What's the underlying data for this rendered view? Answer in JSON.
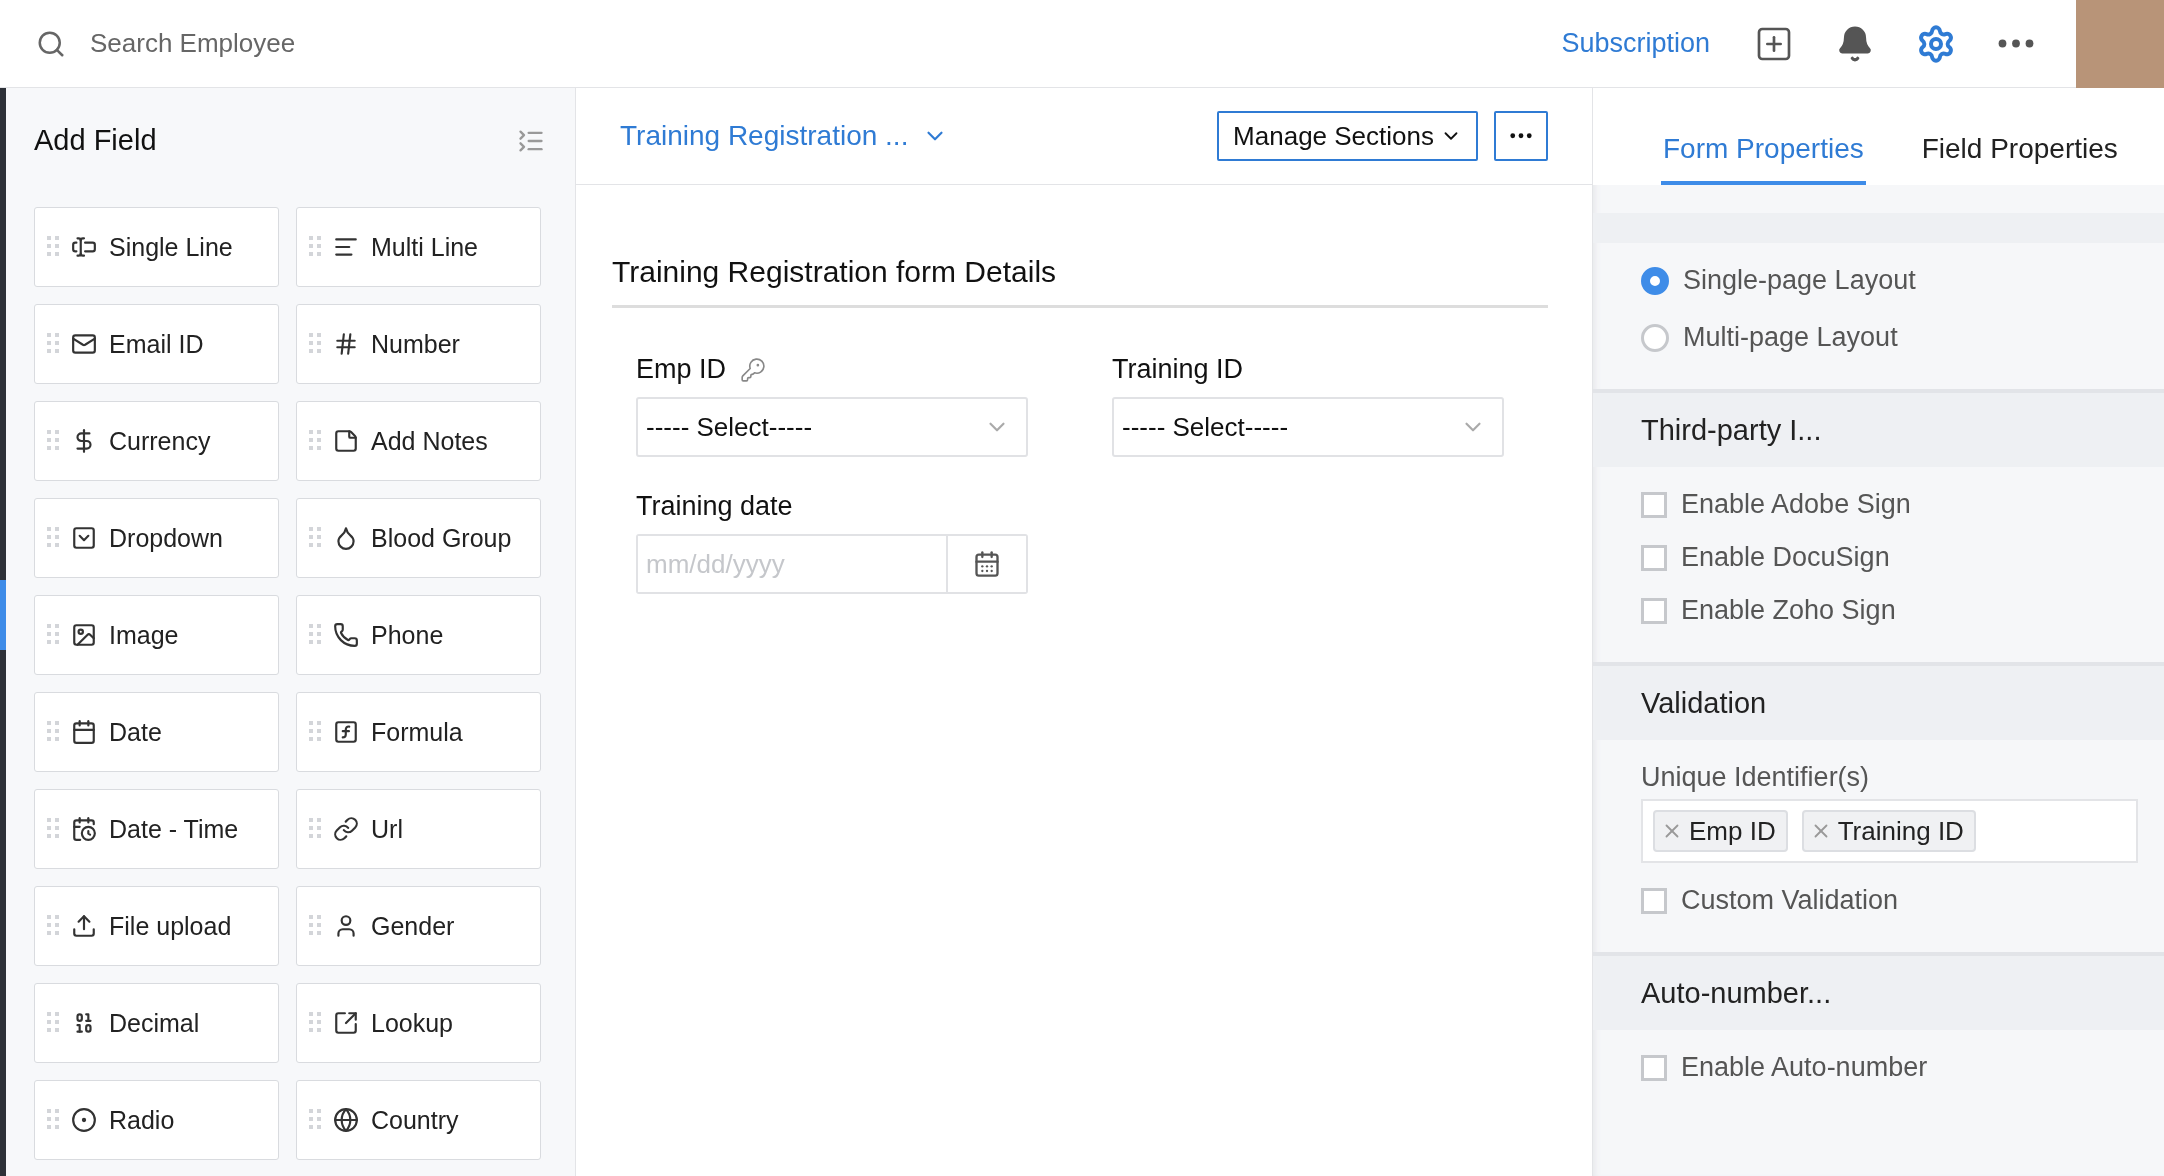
{
  "top_bar": {
    "search_placeholder": "Search Employee",
    "subscription_link": "Subscription"
  },
  "add_field_panel": {
    "title": "Add Field",
    "fields": [
      {
        "label": "Single Line"
      },
      {
        "label": "Multi Line"
      },
      {
        "label": "Email ID"
      },
      {
        "label": "Number"
      },
      {
        "label": "Currency"
      },
      {
        "label": "Add Notes"
      },
      {
        "label": "Dropdown"
      },
      {
        "label": "Blood Group"
      },
      {
        "label": "Image"
      },
      {
        "label": "Phone"
      },
      {
        "label": "Date"
      },
      {
        "label": "Formula"
      },
      {
        "label": "Date - Time"
      },
      {
        "label": "Url"
      },
      {
        "label": "File upload"
      },
      {
        "label": "Gender"
      },
      {
        "label": "Decimal"
      },
      {
        "label": "Lookup"
      },
      {
        "label": "Radio"
      },
      {
        "label": "Country"
      }
    ]
  },
  "form_header": {
    "title": "Training Registration ...",
    "manage_button": "Manage Sections"
  },
  "form": {
    "section_title": "Training Registration form Details",
    "fields": [
      {
        "kind": "select",
        "label": "Emp ID",
        "primary": true,
        "value": "----- Select-----"
      },
      {
        "kind": "select",
        "label": "Training ID",
        "primary": false,
        "value": "----- Select-----"
      },
      {
        "kind": "date",
        "label": "Training date",
        "primary": false,
        "placeholder": "mm/dd/yyyy"
      }
    ]
  },
  "properties_panel": {
    "tabs": [
      {
        "label": "Form Properties",
        "selected": true
      },
      {
        "label": "Field Properties",
        "selected": false
      }
    ],
    "layout_options": [
      {
        "label": "Single-page Layout",
        "selected": true
      },
      {
        "label": "Multi-page Layout",
        "selected": false
      }
    ],
    "sections": [
      {
        "title": "Third-party I...",
        "items": [
          {
            "kind": "checkbox",
            "label": "Enable Adobe Sign",
            "checked": false
          },
          {
            "kind": "checkbox",
            "label": "Enable DocuSign",
            "checked": false
          },
          {
            "kind": "checkbox",
            "label": "Enable Zoho Sign",
            "checked": false
          }
        ]
      },
      {
        "title": "Validation",
        "items": [
          {
            "kind": "tags",
            "label": "Unique Identifier(s)",
            "tags": [
              "Emp ID",
              "Training ID"
            ]
          },
          {
            "kind": "checkbox",
            "label": "Custom Validation",
            "checked": false
          }
        ]
      },
      {
        "title": "Auto-number...",
        "items": [
          {
            "kind": "checkbox",
            "label": "Enable Auto-number",
            "checked": false
          }
        ]
      }
    ]
  }
}
